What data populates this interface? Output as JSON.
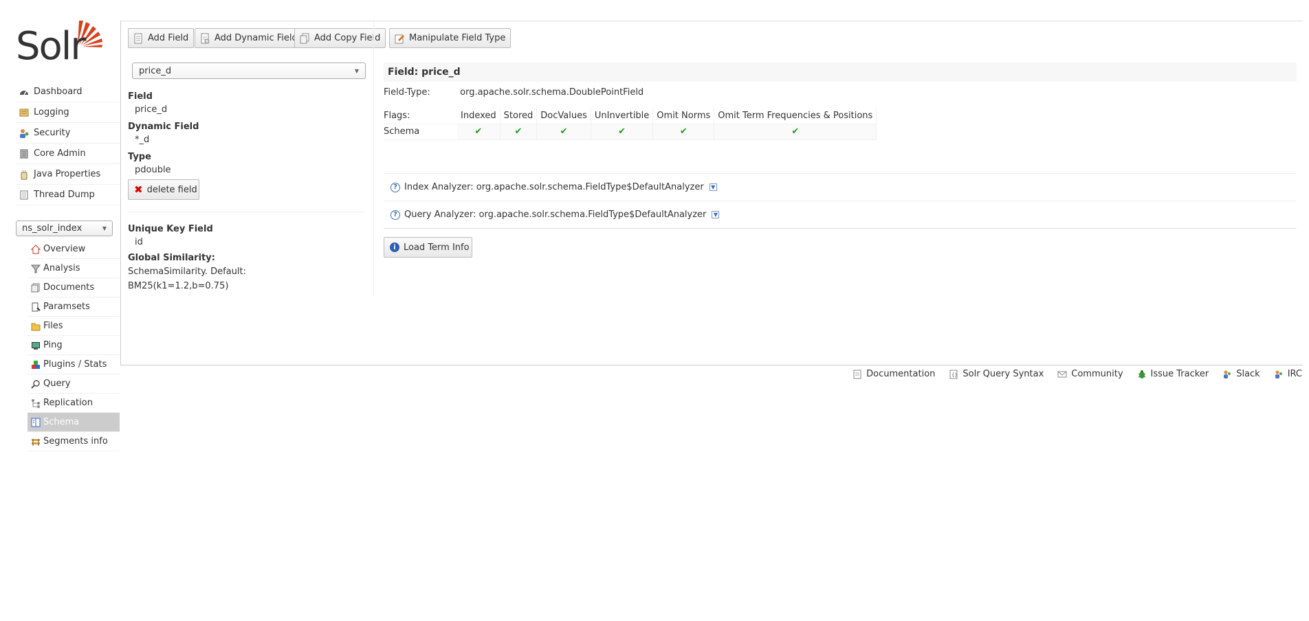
{
  "logo": {
    "text": "Solr"
  },
  "sidebar": {
    "items": [
      {
        "label": "Dashboard",
        "icon": "dashboard-icon"
      },
      {
        "label": "Logging",
        "icon": "logging-icon"
      },
      {
        "label": "Security",
        "icon": "security-icon"
      },
      {
        "label": "Core Admin",
        "icon": "core-admin-icon"
      },
      {
        "label": "Java Properties",
        "icon": "java-properties-icon"
      },
      {
        "label": "Thread Dump",
        "icon": "thread-dump-icon"
      }
    ],
    "core_selector": "ns_solr_index",
    "core_items": [
      {
        "label": "Overview",
        "icon": "home-icon"
      },
      {
        "label": "Analysis",
        "icon": "funnel-icon"
      },
      {
        "label": "Documents",
        "icon": "documents-icon"
      },
      {
        "label": "Paramsets",
        "icon": "paramsets-icon"
      },
      {
        "label": "Files",
        "icon": "folder-icon"
      },
      {
        "label": "Ping",
        "icon": "ping-icon"
      },
      {
        "label": "Plugins / Stats",
        "icon": "plugins-icon"
      },
      {
        "label": "Query",
        "icon": "search-icon"
      },
      {
        "label": "Replication",
        "icon": "replication-icon"
      },
      {
        "label": "Schema",
        "icon": "schema-icon",
        "active": true
      },
      {
        "label": "Segments info",
        "icon": "segments-icon"
      }
    ]
  },
  "toolbar": {
    "add_field": "Add Field",
    "add_dynamic_field": "Add Dynamic Field",
    "add_copy_field": "Add Copy Field",
    "manipulate_field_type": "Manipulate Field Type"
  },
  "left": {
    "selected_field": "price_d",
    "field_label": "Field",
    "field_value": "price_d",
    "dynamic_label": "Dynamic Field",
    "dynamic_value": "*_d",
    "type_label": "Type",
    "type_value": "pdouble",
    "delete_label": "delete field",
    "unique_key_label": "Unique Key Field",
    "unique_key_value": "id",
    "similarity_label": "Global Similarity:",
    "similarity_value": "SchemaSimilarity. Default: BM25(k1=1.2,b=0.75)"
  },
  "detail": {
    "title": "Field: price_d",
    "field_type_label": "Field-Type:",
    "field_type_value": "org.apache.solr.schema.DoublePointField",
    "flags_label": "Flags:",
    "flag_columns": [
      "Indexed",
      "Stored",
      "DocValues",
      "UnInvertible",
      "Omit Norms",
      "Omit Term Frequencies & Positions"
    ],
    "schema_row_label": "Schema",
    "schema_flags": [
      true,
      true,
      true,
      true,
      true,
      true
    ],
    "check_glyph": "✔",
    "index_analyzer": "Index Analyzer: org.apache.solr.schema.FieldType$DefaultAnalyzer",
    "query_analyzer": "Query Analyzer: org.apache.solr.schema.FieldType$DefaultAnalyzer",
    "load_term_info": "Load Term Info"
  },
  "footer": {
    "links": [
      "Documentation",
      "Solr Query Syntax",
      "Community",
      "Issue Tracker",
      "Slack",
      "IRC"
    ]
  },
  "colors": {
    "logo_red": "#d9411e",
    "check_green": "#1a9a1a",
    "active_bg": "#cccccc"
  }
}
